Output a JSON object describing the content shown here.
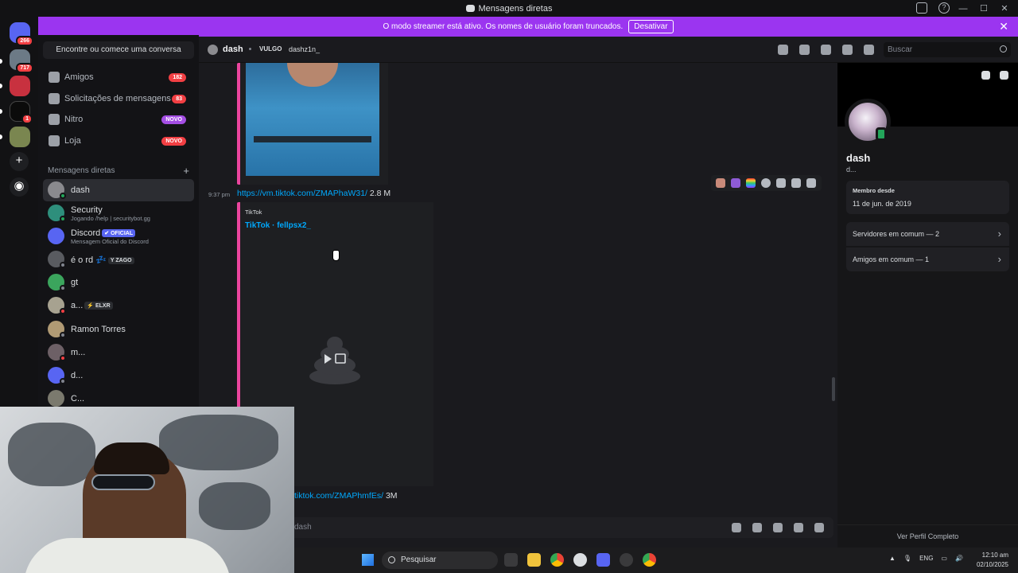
{
  "window": {
    "title": "Mensagens diretas"
  },
  "streamer_bar": {
    "message": "O modo streamer está ativo. Os nomes de usuário foram truncados.",
    "button": "Desativar"
  },
  "servers": [
    {
      "name": "discord-home",
      "badge": "266",
      "color": "#5865f2"
    },
    {
      "name": "server-2",
      "badge": "717",
      "color": "#6c7a86"
    },
    {
      "name": "server-3",
      "badge": "",
      "color": "#c8313f"
    },
    {
      "name": "server-4",
      "badge": "1",
      "color": "#0b0b0b"
    },
    {
      "name": "server-5",
      "badge": "",
      "color": "#7a8650"
    }
  ],
  "dm_sidebar": {
    "find_button": "Encontre ou comece uma conversa",
    "top_items": [
      {
        "label": "Amigos",
        "pill": "182",
        "pill_color": "#f23f43"
      },
      {
        "label": "Solicitações de mensagens",
        "pill": "83",
        "pill_color": "#f23f43"
      },
      {
        "label": "Nitro",
        "pill": "NOVO",
        "pill_color": "#a44ee4"
      },
      {
        "label": "Loja",
        "pill": "NOVO",
        "pill_color": "#f23f43"
      }
    ],
    "header": "Mensagens diretas",
    "dms": [
      {
        "name": "dash",
        "sub": "",
        "tag": "",
        "av": "#8a8a8e",
        "status": "#23a55a"
      },
      {
        "name": "Security",
        "sub": "Jogando /help | securitybot.gg",
        "tag": "",
        "av": "#2e8f7c",
        "status": "#23a55a"
      },
      {
        "name": "Discord",
        "sub": "Mensagem Oficial do Discord",
        "tag": "✔ OFICIAL",
        "av": "#5865f2",
        "status": ""
      },
      {
        "name": "é o rd 💤",
        "sub": "",
        "tag": "Y ZAGO",
        "av": "#595b60",
        "status": "#80848e"
      },
      {
        "name": "gt",
        "sub": "",
        "tag": "",
        "av": "#3ba55d",
        "status": "#80848e"
      },
      {
        "name": "a...",
        "sub": "",
        "tag": "⚡ ELXR",
        "av": "#a7a290",
        "status": "#f23f43"
      },
      {
        "name": "Ramon Torres",
        "sub": "",
        "tag": "",
        "av": "#b09a74",
        "status": "#80848e"
      },
      {
        "name": "m...",
        "sub": "",
        "tag": "",
        "av": "#6d6066",
        "status": "#f23f43"
      },
      {
        "name": "d...",
        "sub": "",
        "tag": "",
        "av": "#5865f2",
        "status": "#80848e"
      },
      {
        "name": "C...",
        "sub": "",
        "tag": "",
        "av": "#7b7a6e",
        "status": ""
      }
    ]
  },
  "chat_header": {
    "name": "dash",
    "vulgo": "VULGO",
    "tag": "dashz1n_",
    "search_placeholder": "Buscar"
  },
  "messages": {
    "time": "9:37 pm",
    "link1": "https://vm.tiktok.com/ZMAPhaW31/",
    "link1_size": "2.8 M",
    "embed_provider": "TikTok",
    "embed_title": "TikTok · fellpsx2_",
    "link2": "tiktok.com/ZMAPhmfEs/",
    "link2_size": "3M"
  },
  "composer": {
    "placeholder": "dash"
  },
  "profile": {
    "name": "dash",
    "tag": "d...",
    "member_since_label": "Membro desde",
    "member_since": "11 de jun. de 2019",
    "mutual_servers": "Servidores em comum — 2",
    "mutual_friends": "Amigos em comum — 1",
    "full_profile": "Ver Perfil Completo"
  },
  "taskbar": {
    "search": "Pesquisar",
    "lang": "ENG",
    "time": "12:10 am",
    "date": "02/10/2025"
  }
}
